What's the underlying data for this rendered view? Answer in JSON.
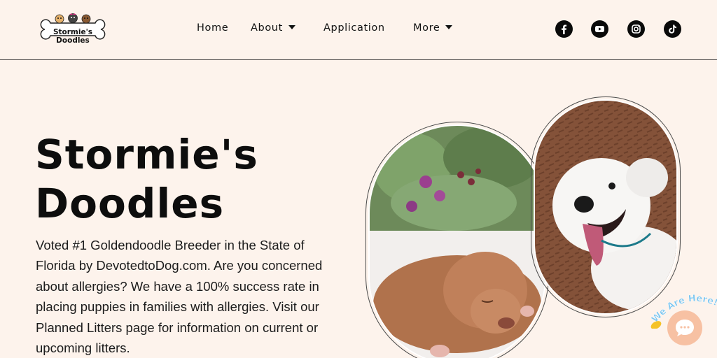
{
  "logo": {
    "text": "Stormie's Doodles"
  },
  "nav": {
    "items": [
      {
        "label": "Home",
        "has_dropdown": false
      },
      {
        "label": "About",
        "has_dropdown": true
      },
      {
        "label": "Application",
        "has_dropdown": false
      },
      {
        "label": "More",
        "has_dropdown": true
      }
    ]
  },
  "social": [
    {
      "icon": "facebook-icon"
    },
    {
      "icon": "youtube-icon"
    },
    {
      "icon": "instagram-icon"
    },
    {
      "icon": "tiktok-icon"
    }
  ],
  "hero": {
    "title_line1": "Stormie's",
    "title_line2": "Doodles",
    "description": "Voted #1 Goldendoodle Breeder in the State of Florida by DevotedtoDog.com. Are you concerned about allergies? We have a 100% success rate in placing puppies in families with allergies. Visit our Planned Litters page for information on current or upcoming litters."
  },
  "chat": {
    "label": "We Are Here!",
    "icon": "chat-bubble-icon"
  },
  "colors": {
    "background": "#fdf3ec",
    "text": "#111111",
    "chat_accent": "#f7c1a3",
    "chat_label": "#7cc6f0"
  }
}
